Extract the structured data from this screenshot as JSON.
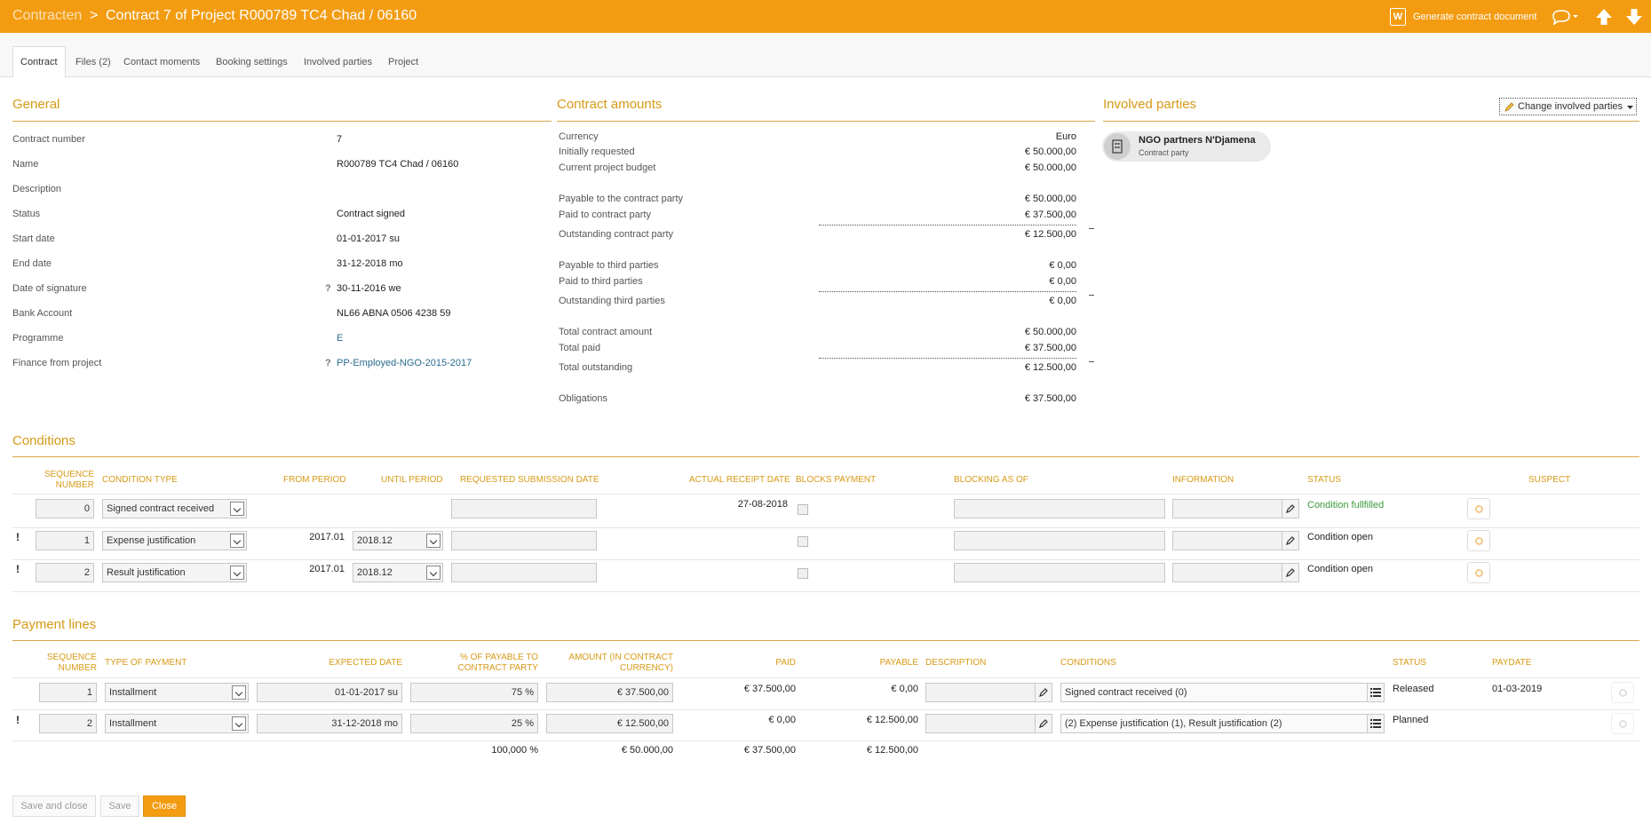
{
  "header": {
    "crumb_root": "Contracten",
    "crumb_sep": ">",
    "title": "Contract 7 of Project R000789 TC4 Chad / 06160",
    "generate_doc_label": "Generate contract document",
    "word_icon_letter": "W"
  },
  "tabs": [
    {
      "label": "Contract"
    },
    {
      "label": "Files (2)"
    },
    {
      "label": "Contact moments"
    },
    {
      "label": "Booking settings"
    },
    {
      "label": "Involved parties"
    },
    {
      "label": "Project"
    }
  ],
  "general": {
    "title": "General",
    "fields": [
      {
        "label": "Contract number",
        "value": "7"
      },
      {
        "label": "Name",
        "value": "R000789 TC4 Chad / 06160"
      },
      {
        "label": "Description",
        "value": ""
      },
      {
        "label": "Status",
        "value": "Contract signed"
      },
      {
        "label": "Start date",
        "value": "01-01-2017 su"
      },
      {
        "label": "End date",
        "value": "31-12-2018 mo"
      },
      {
        "label": "Date of signature",
        "value": "30-11-2016 we"
      },
      {
        "label": "Bank Account",
        "value": "NL66 ABNA 0506 4238 59"
      },
      {
        "label": "Programme",
        "value": "E"
      },
      {
        "label": "Finance from project",
        "value": "PP-Employed-NGO-2015-2017"
      }
    ],
    "qmark": "?"
  },
  "amounts": {
    "title": "Contract amounts",
    "rows": [
      {
        "label": "Currency",
        "value": "Euro"
      },
      {
        "label": "Initially requested",
        "value": "€ 50.000,00"
      },
      {
        "label": "Current project budget",
        "value": "€ 50.000,00"
      },
      {
        "label": "Payable to the contract party",
        "value": "€ 50.000,00"
      },
      {
        "label": "Paid to contract party",
        "value": "€ 37.500,00"
      },
      {
        "label": "Outstanding contract party",
        "value": "€ 12.500,00"
      },
      {
        "label": "Payable to third parties",
        "value": "€ 0,00"
      },
      {
        "label": "Paid to third parties",
        "value": "€ 0,00"
      },
      {
        "label": "Outstanding third parties",
        "value": "€ 0,00"
      },
      {
        "label": "Total contract amount",
        "value": "€ 50.000,00"
      },
      {
        "label": "Total paid",
        "value": "€ 37.500,00"
      },
      {
        "label": "Total outstanding",
        "value": "€ 12.500,00"
      },
      {
        "label": "Obligations",
        "value": "€ 37.500,00"
      }
    ]
  },
  "involved": {
    "title": "Involved parties",
    "change_label": "Change involved parties",
    "party_name": "NGO partners N'Djamena",
    "party_role": "Contract party"
  },
  "conditions": {
    "title": "Conditions",
    "headers": {
      "seq1": "Sequence",
      "seq2": "number",
      "type": "Condition type",
      "from": "From period",
      "until": "Until period",
      "requested": "Requested submission date",
      "actual": "Actual receipt date",
      "blocks": "Blocks payment",
      "blocking": "Blocking as of",
      "info": "Information",
      "status": "Status",
      "suspect": "Suspect"
    },
    "rows": [
      {
        "flag": "",
        "seq": "0",
        "type": "Signed contract received",
        "from": "",
        "until": "",
        "actual": "27-08-2018",
        "status": "Condition fullfilled"
      },
      {
        "flag": "!",
        "seq": "1",
        "type": "Expense justification",
        "from": "2017.01",
        "until": "2018.12",
        "actual": "",
        "status": "Condition open"
      },
      {
        "flag": "!",
        "seq": "2",
        "type": "Result justification",
        "from": "2017.01",
        "until": "2018.12",
        "actual": "",
        "status": "Condition open"
      }
    ]
  },
  "payments": {
    "title": "Payment lines",
    "headers": {
      "seq1": "Sequence",
      "seq2": "number",
      "type": "Type of payment",
      "expected": "Expected date",
      "pct1": "% of payable to",
      "pct2": "contract party",
      "amount1": "Amount (in contract",
      "amount2": "currency)",
      "paid": "Paid",
      "payable": "Payable",
      "description": "Description",
      "conditions": "Conditions",
      "status": "Status",
      "paydate": "Paydate"
    },
    "rows": [
      {
        "flag": "",
        "seq": "1",
        "type": "Installment",
        "expected": "01-01-2017 su",
        "pct": "75 %",
        "amount": "€ 37.500,00",
        "paid": "€ 37.500,00",
        "payable": "€ 0,00",
        "conditions": "Signed contract received (0)",
        "status": "Released",
        "paydate": "01-03-2019"
      },
      {
        "flag": "!",
        "seq": "2",
        "type": "Installment",
        "expected": "31-12-2018 mo",
        "pct": "25 %",
        "amount": "€ 12.500,00",
        "paid": "€ 0,00",
        "payable": "€ 12.500,00",
        "conditions": "(2) Expense justification (1), Result justification (2)",
        "status": "Planned",
        "paydate": ""
      }
    ],
    "totals": {
      "pct": "100,000 %",
      "amount": "€ 50.000,00",
      "paid": "€ 37.500,00",
      "payable": "€ 12.500,00"
    }
  },
  "footer": {
    "save_close": "Save and close",
    "save": "Save",
    "close": "Close"
  },
  "colors": {
    "accent": "#f39c12",
    "heading": "#d79a16",
    "status_ok": "#3a9a3a"
  }
}
